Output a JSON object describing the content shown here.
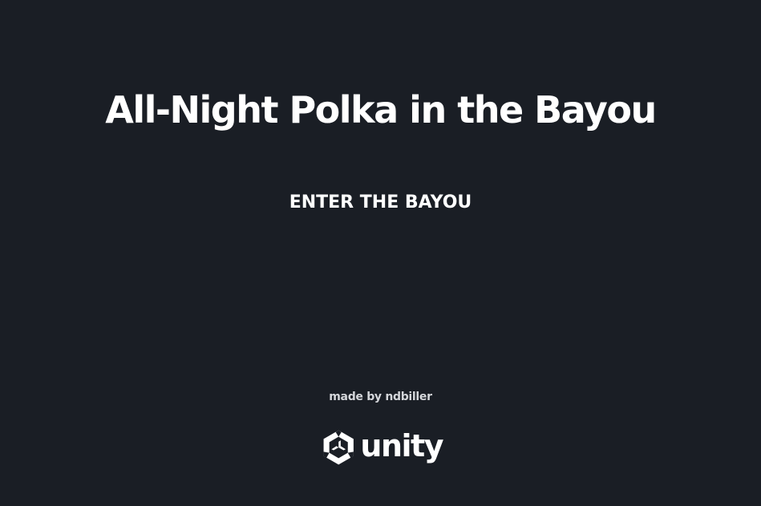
{
  "game": {
    "title": "All-Night Polka in the Bayou",
    "start_label": "ENTER THE BAYOU",
    "credit": "made by ndbiller"
  },
  "engine_logo": {
    "icon": "unity-cube-icon",
    "wordmark": "unity"
  },
  "colors": {
    "background": "#1a1e25",
    "text": "#ffffff",
    "credit_text": "#d4d6da"
  }
}
